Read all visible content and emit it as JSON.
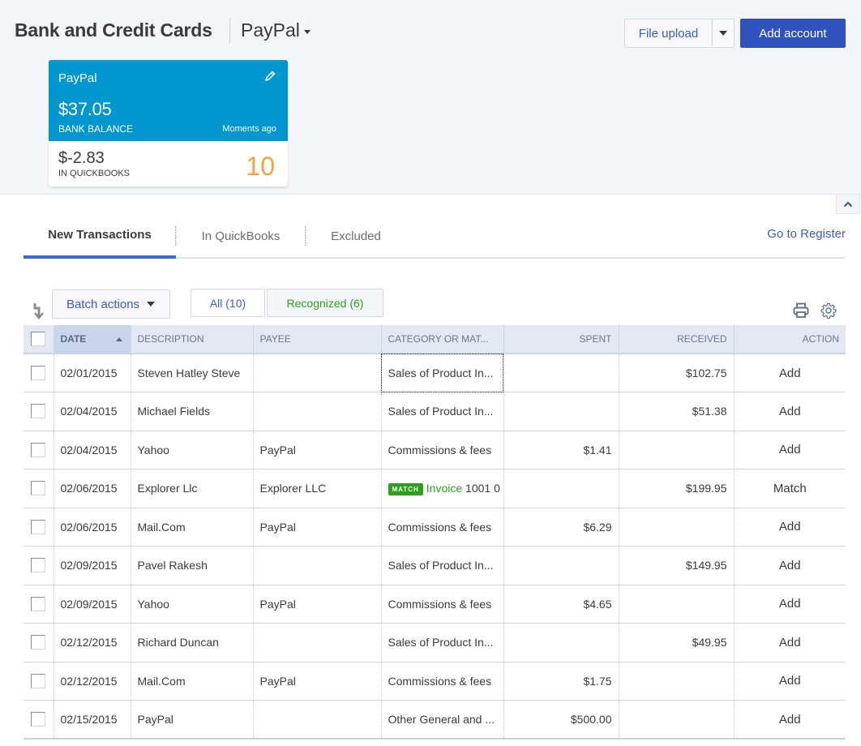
{
  "header": {
    "title": "Bank and Credit Cards",
    "account_selector": "PayPal",
    "file_upload_label": "File upload",
    "add_account_label": "Add account"
  },
  "account_card": {
    "name": "PayPal",
    "bank_balance": "$37.05",
    "bank_balance_label": "BANK BALANCE",
    "updated": "Moments ago",
    "qb_balance": "$-2.83",
    "qb_balance_label": "IN QUICKBOOKS",
    "new_count": "10"
  },
  "colors": {
    "card_blue": "#0096cf",
    "primary_button": "#2f52bf",
    "link_blue": "#3a5cc6",
    "green": "#2ca01c",
    "count_orange": "#f2a33a"
  },
  "tabs": [
    {
      "label": "New Transactions",
      "active": true
    },
    {
      "label": "In QuickBooks",
      "active": false
    },
    {
      "label": "Excluded",
      "active": false
    }
  ],
  "go_to_register": "Go to Register",
  "toolbar": {
    "batch_actions": "Batch actions",
    "filter_all": "All (10)",
    "filter_recognized": "Recognized (6)"
  },
  "table": {
    "columns": [
      "DATE",
      "DESCRIPTION",
      "PAYEE",
      "CATEGORY OR MAT...",
      "SPENT",
      "RECEIVED",
      "ACTION"
    ],
    "rows": [
      {
        "date": "02/01/2015",
        "description": "Steven Hatley Steve",
        "payee": "",
        "category": "Sales of Product In...",
        "category_style": "normal",
        "spent": "",
        "received": "$102.75",
        "action": "Add"
      },
      {
        "date": "02/04/2015",
        "description": "Michael Fields",
        "payee": "",
        "category": "Sales of Product In...",
        "category_style": "normal",
        "spent": "",
        "received": "$51.38",
        "action": "Add"
      },
      {
        "date": "02/04/2015",
        "description": "Yahoo",
        "payee": "PayPal",
        "category": "Commissions & fees",
        "category_style": "green",
        "spent": "$1.41",
        "received": "",
        "action": "Add"
      },
      {
        "date": "02/06/2015",
        "description": "Explorer Llc",
        "payee": "Explorer LLC",
        "category": "Invoice",
        "category_style": "match",
        "match_badge": "MATCH",
        "match_suffix": "1001 0",
        "spent": "",
        "received": "$199.95",
        "action": "Match"
      },
      {
        "date": "02/06/2015",
        "description": "Mail.Com",
        "payee": "PayPal",
        "category": "Commissions & fees",
        "category_style": "green",
        "spent": "$6.29",
        "received": "",
        "action": "Add"
      },
      {
        "date": "02/09/2015",
        "description": "Pavel Rakesh",
        "payee": "",
        "category": "Sales of Product In...",
        "category_style": "normal",
        "spent": "",
        "received": "$149.95",
        "action": "Add"
      },
      {
        "date": "02/09/2015",
        "description": "Yahoo",
        "payee": "PayPal",
        "category": "Commissions & fees",
        "category_style": "green",
        "spent": "$4.65",
        "received": "",
        "action": "Add"
      },
      {
        "date": "02/12/2015",
        "description": "Richard Duncan",
        "payee": "",
        "category": "Sales of Product In...",
        "category_style": "normal",
        "spent": "",
        "received": "$49.95",
        "action": "Add"
      },
      {
        "date": "02/12/2015",
        "description": "Mail.Com",
        "payee": "PayPal",
        "category": "Commissions & fees",
        "category_style": "green",
        "spent": "$1.75",
        "received": "",
        "action": "Add"
      },
      {
        "date": "02/15/2015",
        "description": "PayPal",
        "payee": "",
        "category": "Other General and ...",
        "category_style": "normal",
        "spent": "$500.00",
        "received": "",
        "action": "Add"
      }
    ]
  }
}
